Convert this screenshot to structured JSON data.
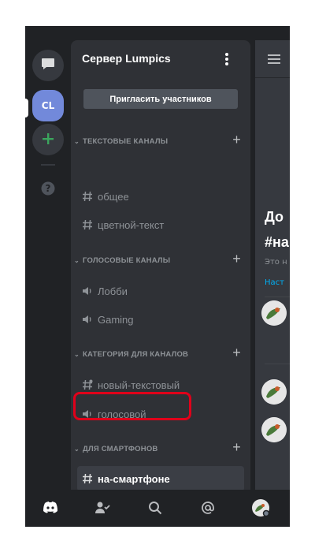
{
  "rail": {
    "server_initials": "CL"
  },
  "server": {
    "name": "Сервер Lumpics",
    "invite_label": "Пригласить участников"
  },
  "categories": [
    {
      "label": "Текстовые каналы"
    },
    {
      "label": "Голосовые каналы"
    },
    {
      "label": "Категория для каналов"
    },
    {
      "label": "Для смартфонов"
    }
  ],
  "channels": [
    {
      "name": "общее",
      "type": "text"
    },
    {
      "name": "цветной-текст",
      "type": "text"
    },
    {
      "name": "Лобби",
      "type": "voice"
    },
    {
      "name": "Gaming",
      "type": "voice"
    },
    {
      "name": "новый-текстовый",
      "type": "text-locked"
    },
    {
      "name": "голосовой",
      "type": "voice-locked"
    },
    {
      "name": "на-смартфоне",
      "type": "text",
      "active": true
    }
  ],
  "chat_peek": {
    "title_1": "До",
    "title_2": "#на",
    "sub": "Это н",
    "link": "Наст"
  },
  "colors": {
    "background": "#202225",
    "panel": "#2f3136",
    "chat": "#36393f",
    "accent": "#7289da",
    "green": "#3ba55d",
    "highlight": "#e0001a"
  },
  "icons": [
    "chat-bubble-icon",
    "add-server-icon",
    "help-icon",
    "hash-icon",
    "speaker-icon",
    "discord-home-icon",
    "friends-icon",
    "search-icon",
    "mentions-icon",
    "user-avatar"
  ]
}
